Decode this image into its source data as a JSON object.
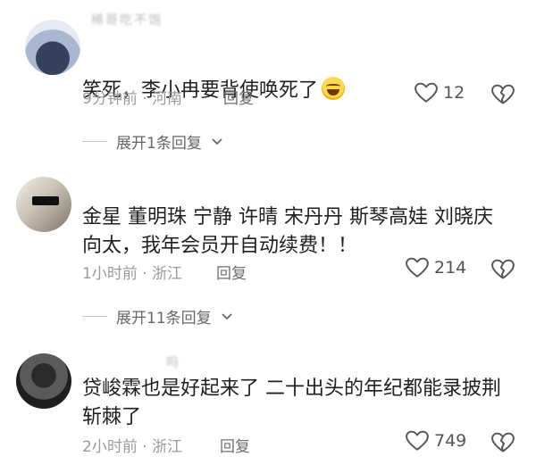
{
  "comments": [
    {
      "username": "稀哥吃不饱",
      "text": "笑死，李小冉要背使唤死了",
      "emoji": "grinning-sweat-emoji",
      "time": "9分钟前",
      "location": "河南",
      "reply_label": "回复",
      "likes": "12",
      "expand_label": "展开1条回复"
    },
    {
      "username": "",
      "text": "金星 董明珠 宁静 许晴 宋丹丹 斯琴高娃 刘晓庆\n向太，我年会员开自动续费！！",
      "time": "1小时前",
      "location": "浙江",
      "reply_label": "回复",
      "likes": "214",
      "expand_label": "展开11条回复"
    },
    {
      "username": "吗",
      "text": "贷峻霖也是好起来了 二十出头的年纪都能录披荆\n斩棘了",
      "time": "2小时前",
      "location": "浙江",
      "reply_label": "回复",
      "likes": "749"
    }
  ],
  "separator": " · ",
  "icons": {
    "like": "heart-outline-icon",
    "dislike": "broken-heart-icon",
    "expand": "chevron-down-icon"
  }
}
